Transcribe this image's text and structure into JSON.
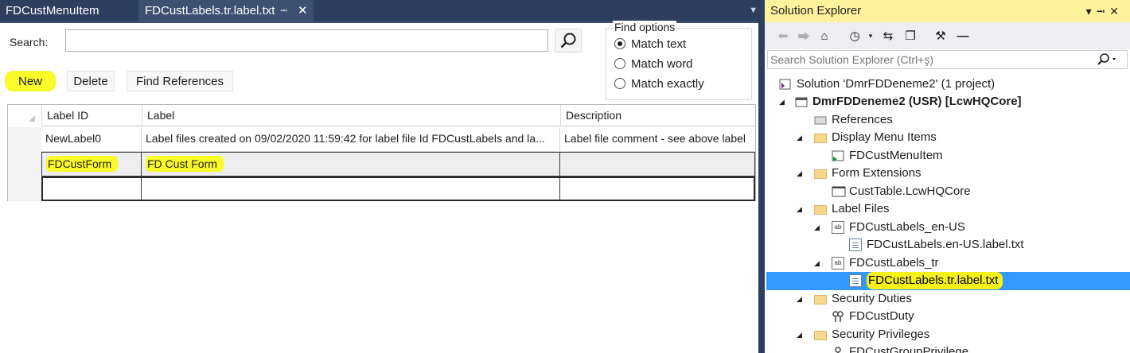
{
  "editor": {
    "tabs": [
      {
        "label": "FDCustMenuItem"
      },
      {
        "label": "FDCustLabels.tr.label.txt"
      }
    ],
    "search_label": "Search:",
    "search_value": "",
    "find_options": {
      "title": "Find options",
      "options": [
        {
          "label": "Match text",
          "selected": true
        },
        {
          "label": "Match word",
          "selected": false
        },
        {
          "label": "Match exactly",
          "selected": false
        }
      ]
    },
    "toolbar": {
      "new_label": "New",
      "delete_label": "Delete",
      "find_references_label": "Find References"
    },
    "grid": {
      "columns": [
        "Label ID",
        "Label",
        "Description"
      ],
      "rows": [
        [
          "NewLabel0",
          "Label files created on 09/02/2020 11:59:42 for label file Id FDCustLabels and la...",
          "Label file comment - see above label"
        ],
        [
          "FDCustForm",
          "FD Cust Form",
          ""
        ],
        [
          "",
          "",
          ""
        ]
      ]
    }
  },
  "solution_explorer": {
    "title": "Solution Explorer",
    "search_placeholder": "Search Solution Explorer (Ctrl+ş)",
    "tree": [
      {
        "label": "Solution 'DmrFDDeneme2' (1 project)",
        "icon": "solution-icon"
      },
      {
        "label": "DmrFDDeneme2 (USR) [LcwHQCore]",
        "icon": "project-icon"
      },
      {
        "label": "References",
        "icon": "folder-icon"
      },
      {
        "label": "Display Menu Items",
        "icon": "folder-icon"
      },
      {
        "label": "FDCustMenuItem",
        "icon": "menu-item-icon"
      },
      {
        "label": "Form Extensions",
        "icon": "folder-icon"
      },
      {
        "label": "CustTable.LcwHQCore",
        "icon": "form-icon"
      },
      {
        "label": "Label Files",
        "icon": "folder-icon"
      },
      {
        "label": "FDCustLabels_en-US",
        "icon": "label-file-icon"
      },
      {
        "label": "FDCustLabels.en-US.label.txt",
        "icon": "text-file-icon"
      },
      {
        "label": "FDCustLabels_tr",
        "icon": "label-file-icon"
      },
      {
        "label": "FDCustLabels.tr.label.txt",
        "icon": "text-file-icon",
        "selected": true
      },
      {
        "label": "Security Duties",
        "icon": "folder-icon"
      },
      {
        "label": "FDCustDuty",
        "icon": "duty-icon"
      },
      {
        "label": "Security Privileges",
        "icon": "folder-icon"
      },
      {
        "label": "FDCustGroupPrivilege",
        "icon": "privilege-icon"
      }
    ]
  },
  "colors": {
    "tab_bar": "#2d3e5f",
    "highlight_yellow": "#fbfb2a",
    "selection_blue": "#3399ff",
    "se_title_bar": "#fff29d"
  }
}
